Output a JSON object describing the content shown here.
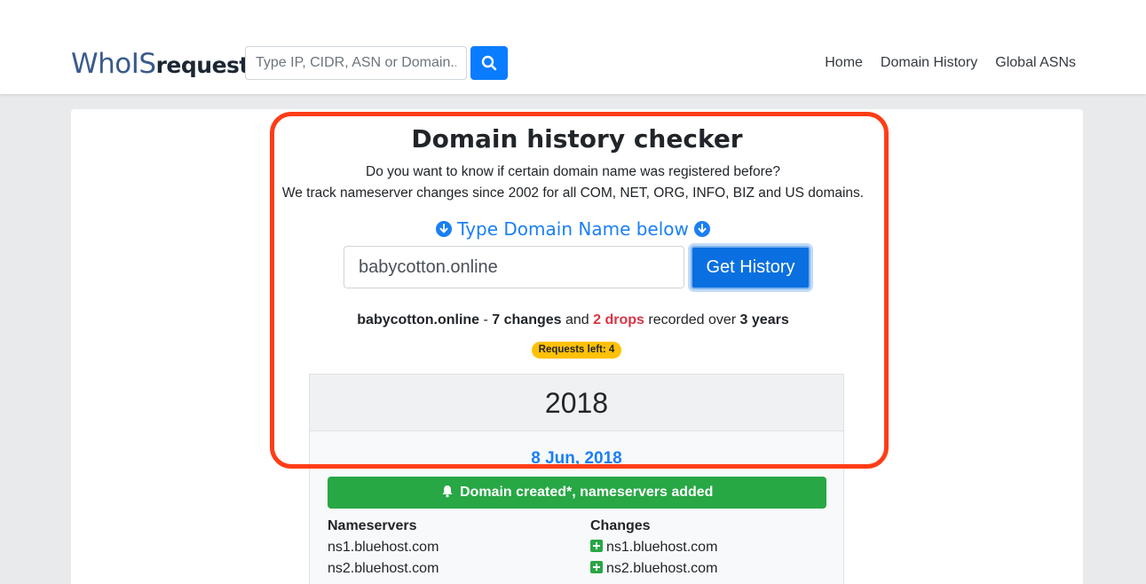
{
  "header": {
    "logo_part1": "WhoIS",
    "logo_part2": "request",
    "search_placeholder": "Type IP, CIDR, ASN or Domain..",
    "nav": [
      "Home",
      "Domain History",
      "Global ASNs"
    ]
  },
  "main": {
    "title": "Domain history checker",
    "desc_line1": "Do you want to know if certain domain name was registered before?",
    "desc_line2": "We track nameserver changes since 2002 for all COM, NET, ORG, INFO, BIZ and US domains.",
    "type_label": "Type Domain Name below",
    "domain_value": "babycotton.online",
    "button_label": "Get History",
    "summary": {
      "domain": "babycotton.online",
      "sep": " - ",
      "changes": "7 changes",
      "and": " and ",
      "drops": "2 drops",
      "recorded": " recorded over ",
      "years": "3 years"
    },
    "badge": "Requests left: 4"
  },
  "history": {
    "year": "2018",
    "date": "8 Jun, 2018",
    "event": "Domain created*, nameservers added",
    "ns_header": "Nameservers",
    "changes_header": "Changes",
    "nameservers": [
      "ns1.bluehost.com",
      "ns2.bluehost.com"
    ],
    "changes": [
      "ns1.bluehost.com",
      "ns2.bluehost.com"
    ]
  },
  "colors": {
    "accent": "#0a7cff",
    "highlight": "#ff3d17",
    "success": "#28a745",
    "badge": "#ffc107",
    "danger": "#dc3545"
  }
}
